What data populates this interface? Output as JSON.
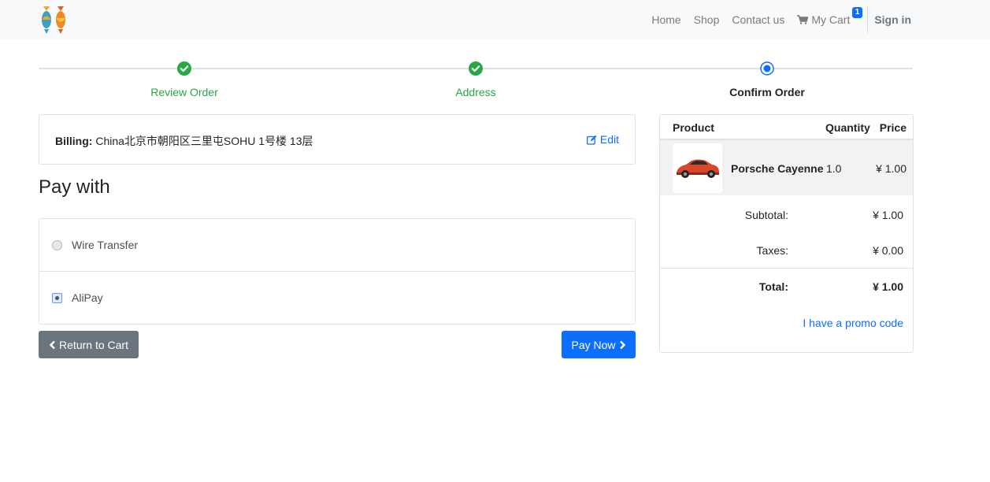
{
  "nav": {
    "links": [
      "Home",
      "Shop",
      "Contact us"
    ],
    "cart_label": "My Cart",
    "cart_count": "1",
    "signin_label": "Sign in"
  },
  "steps": [
    {
      "label": "Review Order",
      "state": "done"
    },
    {
      "label": "Address",
      "state": "done"
    },
    {
      "label": "Confirm Order",
      "state": "active"
    }
  ],
  "billing": {
    "label": "Billing:",
    "address": "China北京市朝阳区三里屯SOHU 1号楼 13层",
    "edit_label": "Edit"
  },
  "pay_with_title": "Pay with",
  "payment_options": [
    {
      "label": "Wire Transfer",
      "selected": false
    },
    {
      "label": "AliPay",
      "selected": true
    }
  ],
  "buttons": {
    "return_label": "Return to Cart",
    "pay_label": "Pay Now"
  },
  "summary": {
    "headers": {
      "product": "Product",
      "quantity": "Quantity",
      "price": "Price"
    },
    "item": {
      "name": "Porsche Cayenne",
      "quantity": "1.0",
      "price": "¥ 1.00"
    },
    "subtotal_label": "Subtotal:",
    "subtotal_value": "¥ 1.00",
    "taxes_label": "Taxes:",
    "taxes_value": "¥ 0.00",
    "total_label": "Total:",
    "total_value": "¥ 1.00",
    "promo_label": "I have a promo code"
  },
  "colors": {
    "accent": "#0d6efd",
    "success": "#28a745",
    "secondary": "#6c757d"
  }
}
